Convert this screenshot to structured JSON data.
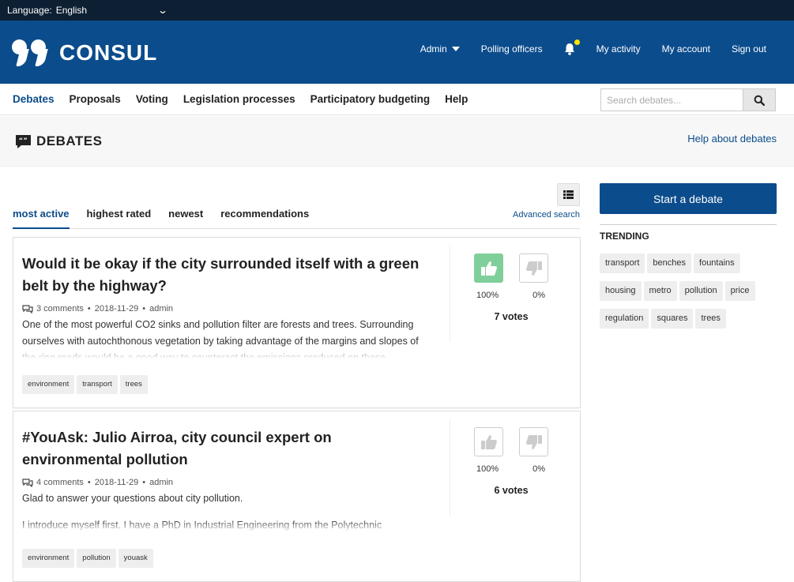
{
  "language_bar": {
    "label": "Language:",
    "selected": "English"
  },
  "brand": {
    "name": "CONSUL"
  },
  "top_nav": {
    "admin": "Admin",
    "polling_officers": "Polling officers",
    "my_activity": "My activity",
    "my_account": "My account",
    "sign_out": "Sign out"
  },
  "main_nav": [
    "Debates",
    "Proposals",
    "Voting",
    "Legislation processes",
    "Participatory budgeting",
    "Help"
  ],
  "search": {
    "placeholder": "Search debates..."
  },
  "page": {
    "title": "DEBATES",
    "help_link": "Help about debates"
  },
  "tabs": [
    "most active",
    "highest rated",
    "newest",
    "recommendations"
  ],
  "advanced_search": "Advanced search",
  "debates": [
    {
      "title": "Would it be okay if the city surrounded itself with a green belt by the highway?",
      "comments": "3 comments",
      "date": "2018-11-29",
      "author": "admin",
      "description": [
        "One of the most powerful CO2 sinks and pollution filter are forests and trees. Surrounding ourselves with autochthonous vegetation by taking advantage of the margins and slopes of the ring roads would be a good way to counteract the emissions produced on these"
      ],
      "tags": [
        "environment",
        "transport",
        "trees"
      ],
      "votes_in_favor": "100%",
      "votes_against": "0%",
      "total_votes": "7 votes"
    },
    {
      "title": "#YouAsk: Julio Airroa, city council expert on environmental pollution",
      "comments": "4 comments",
      "date": "2018-11-29",
      "author": "admin",
      "description": [
        "Glad to answer your questions about city pollution.",
        "I introduce myself first. I have a PhD in Industrial Engineering from the Polytechnic"
      ],
      "tags": [
        "environment",
        "pollution",
        "youask"
      ],
      "votes_in_favor": "100%",
      "votes_against": "0%",
      "total_votes": "6 votes"
    }
  ],
  "sidebar": {
    "start_button": "Start a debate",
    "trending_label": "TRENDING",
    "trending_tags": [
      "transport",
      "benches",
      "fountains",
      "housing",
      "metro",
      "pollution",
      "price",
      "regulation",
      "squares",
      "trees"
    ]
  },
  "colors": {
    "brand_blue": "#0b4c8c",
    "dark_bar": "#0d1f33",
    "vote_green": "#7fcf9a",
    "notification_dot": "#ffe600"
  }
}
